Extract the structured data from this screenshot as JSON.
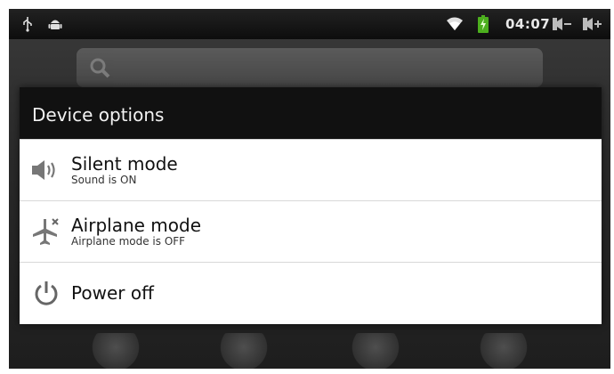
{
  "status_bar": {
    "time": "04:07",
    "icons": [
      "usb-icon",
      "android-debug-icon",
      "wifi-icon",
      "battery-charging-icon",
      "volume-down-icon",
      "volume-up-icon"
    ]
  },
  "dialog": {
    "title": "Device options",
    "items": [
      {
        "icon": "speaker-icon",
        "label": "Silent mode",
        "sub": "Sound is ON"
      },
      {
        "icon": "airplane-icon",
        "label": "Airplane mode",
        "sub": "Airplane mode is OFF"
      },
      {
        "icon": "power-icon",
        "label": "Power off",
        "sub": ""
      }
    ]
  },
  "colors": {
    "status_bar_bg": "#111111",
    "dialog_title_bg": "#111111",
    "battery_green": "#4caf1e",
    "dialog_bg": "#ffffff"
  }
}
